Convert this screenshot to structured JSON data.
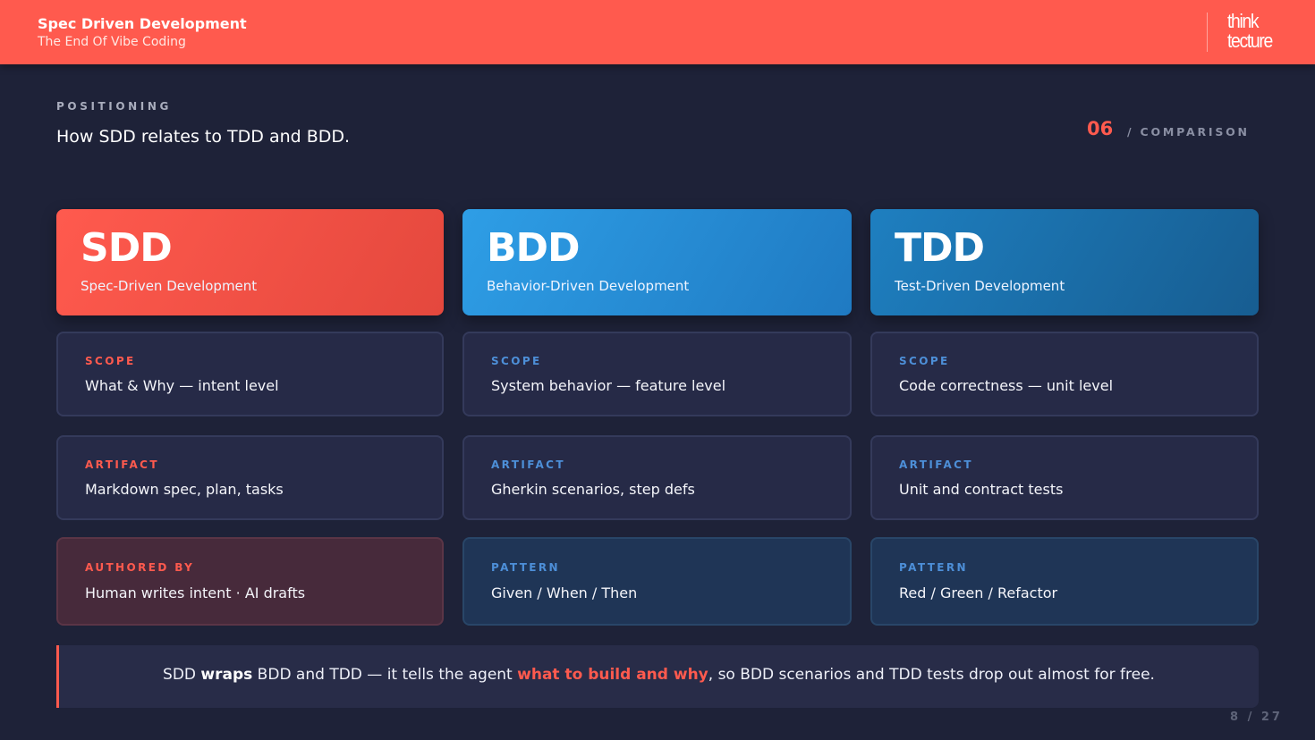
{
  "header": {
    "title": "Spec Driven Development",
    "subtitle": "The End Of Vibe Coding",
    "logo_line1": "think",
    "logo_line2": "tecture"
  },
  "slide": {
    "eyebrow": "POSITIONING",
    "headline": "How SDD relates to TDD and BDD.",
    "section_number": "06",
    "section_label": "/ COMPARISON"
  },
  "columns": [
    {
      "abbr": "SDD",
      "full": "Spec-Driven Development",
      "rows": [
        {
          "label": "SCOPE",
          "value": "What & Why — intent level"
        },
        {
          "label": "ARTIFACT",
          "value": "Markdown spec, plan, tasks"
        },
        {
          "label": "AUTHORED BY",
          "value": "Human writes intent · AI drafts"
        }
      ]
    },
    {
      "abbr": "BDD",
      "full": "Behavior-Driven Development",
      "rows": [
        {
          "label": "SCOPE",
          "value": "System behavior — feature level"
        },
        {
          "label": "ARTIFACT",
          "value": "Gherkin scenarios, step defs"
        },
        {
          "label": "PATTERN",
          "value": "Given / When / Then"
        }
      ]
    },
    {
      "abbr": "TDD",
      "full": "Test-Driven Development",
      "rows": [
        {
          "label": "SCOPE",
          "value": "Code correctness — unit level"
        },
        {
          "label": "ARTIFACT",
          "value": "Unit and contract tests"
        },
        {
          "label": "PATTERN",
          "value": "Red / Green / Refactor"
        }
      ]
    }
  ],
  "callout": {
    "p1": "SDD ",
    "p2": "wraps",
    "p3": " BDD and TDD — it tells the agent ",
    "p4": "what to build and why",
    "p5": ", so BDD scenarios and TDD tests drop out almost for free."
  },
  "pager": "8 / 27",
  "colors": {
    "accent": "#ff5a4e",
    "blue": "#2e9ee6",
    "background": "#1e2238"
  }
}
